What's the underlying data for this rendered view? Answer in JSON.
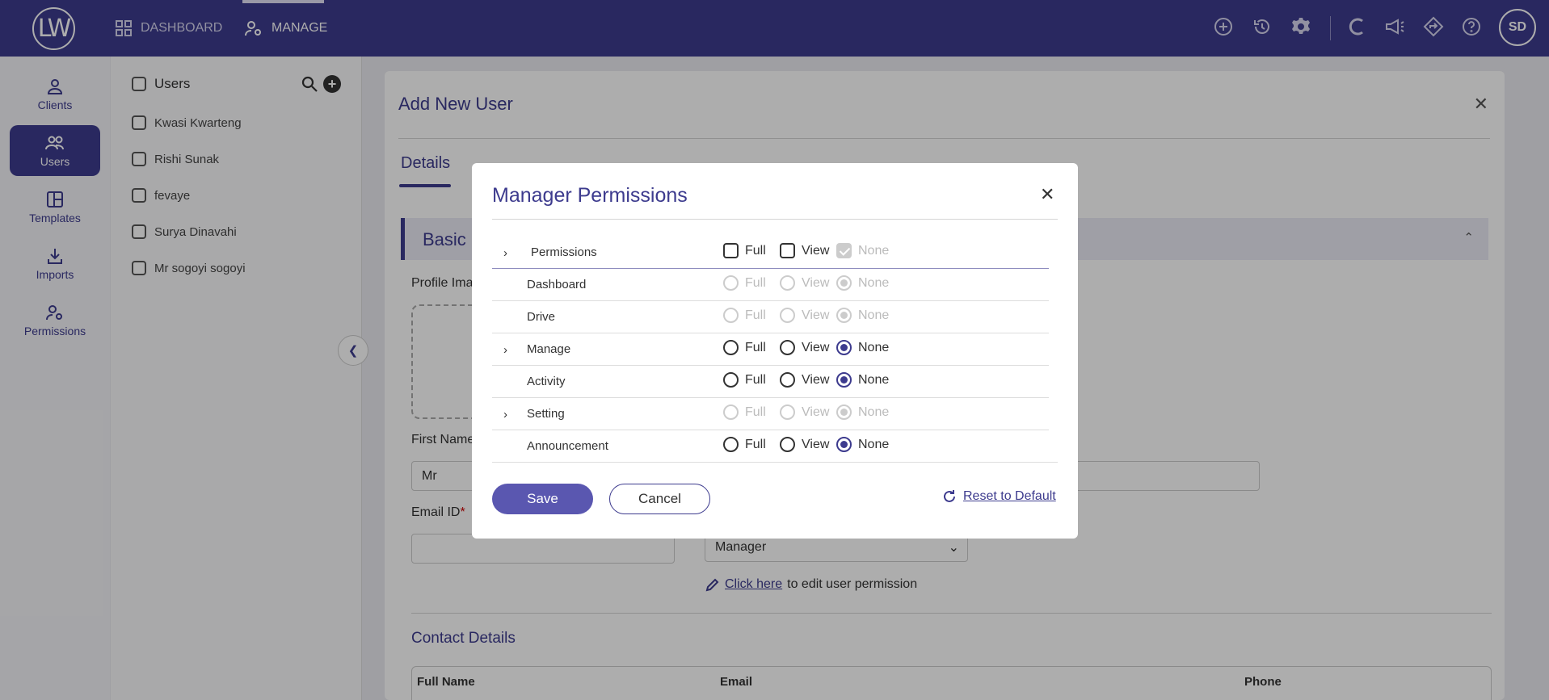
{
  "topbar": {
    "logo": "LW",
    "nav": [
      {
        "label": "DASHBOARD"
      },
      {
        "label": "MANAGE"
      }
    ],
    "avatar": "SD"
  },
  "sidebar": {
    "items": [
      {
        "label": "Clients"
      },
      {
        "label": "Users"
      },
      {
        "label": "Templates"
      },
      {
        "label": "Imports"
      },
      {
        "label": "Permissions"
      }
    ]
  },
  "userlist": {
    "header": "Users",
    "users": [
      "Kwasi Kwarteng",
      "Rishi Sunak",
      "fevaye",
      "Surya Dinavahi",
      "Mr sogoyi sogoyi"
    ]
  },
  "main": {
    "title": "Add New User",
    "tab": "Details",
    "section": "Basic I",
    "profile_label": "Profile Ima",
    "first_name_label": "First Name",
    "salutation": "Mr",
    "email_label": "Email ID",
    "required_mark": "*",
    "role_value": "Manager",
    "click_here": "Click here",
    "edit_text": "to edit user permission",
    "contact_title": "Contact Details",
    "table_headers": [
      "Full Name",
      "Email",
      "Phone"
    ]
  },
  "modal": {
    "title": "Manager Permissions",
    "header_row": {
      "label": "Permissions",
      "full": "Full",
      "view": "View",
      "none": "None"
    },
    "rows": [
      {
        "label": "Dashboard",
        "full": "Full",
        "view": "View",
        "none": "None"
      },
      {
        "label": "Drive",
        "full": "Full",
        "view": "View",
        "none": "None"
      },
      {
        "label": "Manage",
        "full": "Full",
        "view": "View",
        "none": "None"
      },
      {
        "label": "Activity",
        "full": "Full",
        "view": "View",
        "none": "None"
      },
      {
        "label": "Setting",
        "full": "Full",
        "view": "View",
        "none": "None"
      },
      {
        "label": "Announcement",
        "full": "Full",
        "view": "View",
        "none": "None"
      }
    ],
    "save": "Save",
    "cancel": "Cancel",
    "reset": "Reset to Default"
  }
}
